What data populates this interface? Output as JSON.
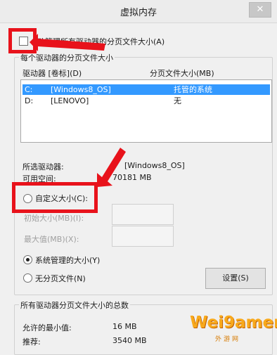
{
  "window": {
    "title": "虚拟内存",
    "close_glyph": "✕"
  },
  "auto_manage": {
    "label": "动管理所有驱动器的分页文件大小(A)",
    "checked": false
  },
  "drives_group": {
    "title": "每个驱动器的分页文件大小",
    "col_drive": "驱动器 [卷标](D)",
    "col_size": "分页文件大小(MB)",
    "rows": [
      {
        "drive": "C:",
        "label": "[Windows8_OS]",
        "size": "托管的系统",
        "selected": true
      },
      {
        "drive": "D:",
        "label": "[LENOVO]",
        "size": "无",
        "selected": false
      }
    ],
    "selected_drive_label": "所选驱动器:",
    "selected_drive_value": "[Windows8_OS]",
    "available_label": "可用空间:",
    "available_value": "70181 MB",
    "custom_size_label": "自定义大小(C):",
    "initial_size_label": "初始大小(MB)(I):",
    "max_size_label": "最大值(MB)(X):",
    "system_managed_label": "系统管理的大小(Y)",
    "no_paging_label": "无分页文件(N)",
    "set_button": "设置(S)",
    "radio_selected": "system_managed"
  },
  "totals_group": {
    "title": "所有驱动器分页文件大小的总数",
    "min_label": "允许的最小值:",
    "min_value": "16 MB",
    "recommended_label": "推荐:",
    "recommended_value": "3540 MB"
  },
  "watermark": {
    "main": "Wei9amer",
    "sub": "外游网"
  },
  "colors": {
    "annotation_red": "#e8121b",
    "selection_blue": "#3399ff"
  }
}
